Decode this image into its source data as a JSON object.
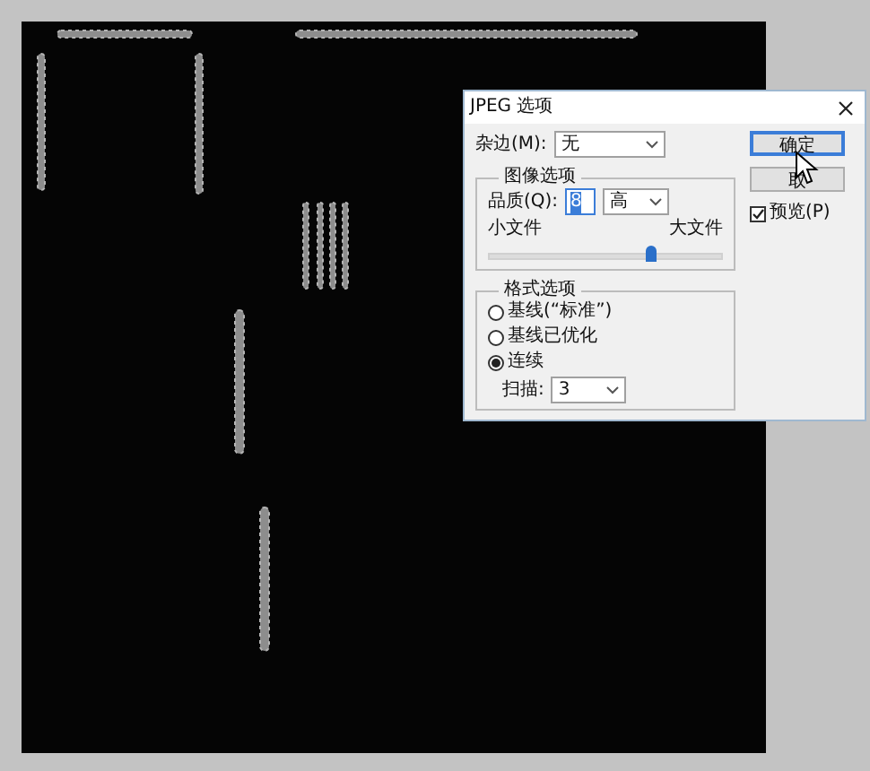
{
  "dialog": {
    "title": "JPEG 选项",
    "matte": {
      "label": "杂边(M):",
      "value": "无"
    },
    "image_options": {
      "title": "图像选项",
      "quality_label": "品质(Q):",
      "quality_value": "8",
      "quality_preset": "高",
      "min_label": "小文件",
      "max_label": "大文件",
      "level": 0.7
    },
    "format_options": {
      "title": "格式选项",
      "options": [
        {
          "label": "基线(“标准”)",
          "selected": false
        },
        {
          "label": "基线已优化",
          "selected": false
        },
        {
          "label": "连续",
          "selected": true
        }
      ],
      "scan_label": "扫描:",
      "scan_value": "3"
    },
    "buttons": [
      {
        "label": "确定",
        "kind": "default"
      },
      {
        "label": "取",
        "kind": "normal"
      }
    ],
    "preview": {
      "label": "预览(P)",
      "checked": true
    }
  }
}
